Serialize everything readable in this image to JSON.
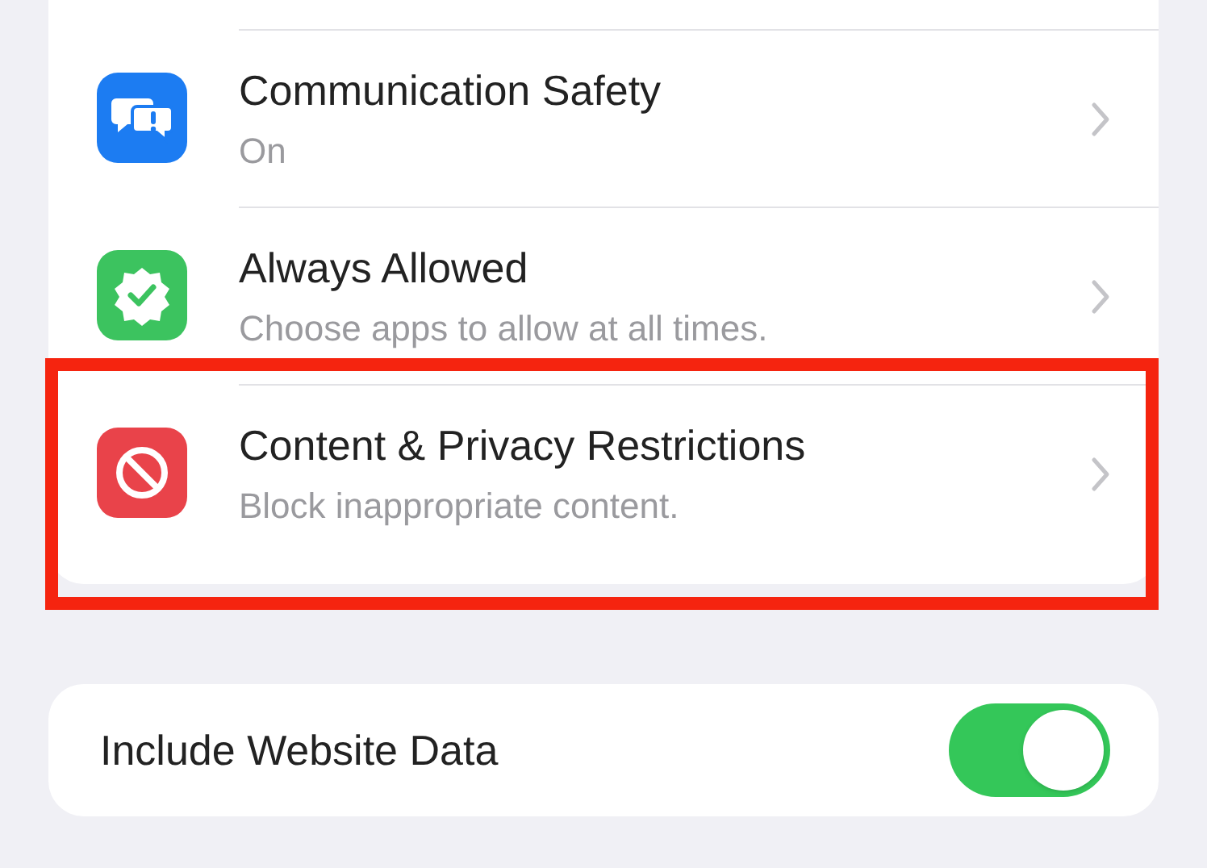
{
  "settings_list": [
    {
      "kind": "chat",
      "title": "Communication Safety",
      "subtitle": "On",
      "highlighted": false
    },
    {
      "kind": "check",
      "title": "Always Allowed",
      "subtitle": "Choose apps to allow at all times.",
      "highlighted": false
    },
    {
      "kind": "block",
      "title": "Content & Privacy Restrictions",
      "subtitle": "Block inappropriate content.",
      "highlighted": true
    }
  ],
  "toggle_row": {
    "label": "Include Website Data",
    "on": true
  }
}
